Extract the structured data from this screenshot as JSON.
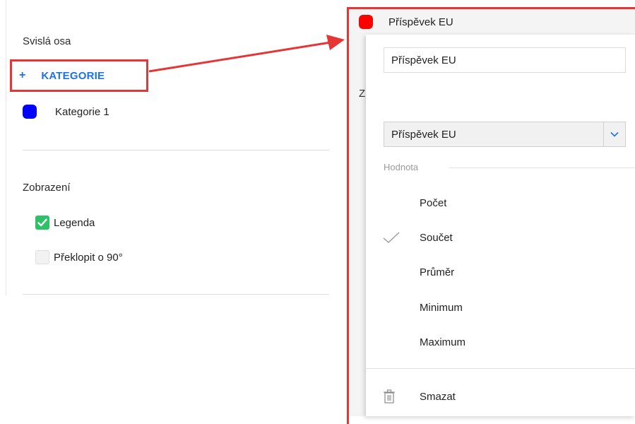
{
  "left": {
    "vertical_axis_title": "Svislá osa",
    "add_category_label": "KATEGORIE",
    "add_category_plus": "+",
    "category": {
      "label": "Kategorie 1",
      "color": "#0000ff"
    },
    "display_title": "Zobrazení",
    "legend_label": "Legenda",
    "legend_checked": true,
    "rotate_label": "Překlopit o 90°",
    "rotate_checked": false
  },
  "popup": {
    "header_title": "Příspěvek EU",
    "header_color": "#ff0000",
    "peek_letter": "Z",
    "name_value": "Příspěvek EU",
    "field_select_value": "Příspěvek EU",
    "value_group_label": "Hodnota",
    "aggregations": [
      {
        "label": "Počet",
        "selected": false
      },
      {
        "label": "Součet",
        "selected": true
      },
      {
        "label": "Průměr",
        "selected": false
      },
      {
        "label": "Minimum",
        "selected": false
      },
      {
        "label": "Maximum",
        "selected": false
      }
    ],
    "delete_label": "Smazat"
  },
  "colors": {
    "accent_blue": "#1a73e8",
    "highlight_red": "#e53535",
    "check_green": "#2fc167"
  }
}
